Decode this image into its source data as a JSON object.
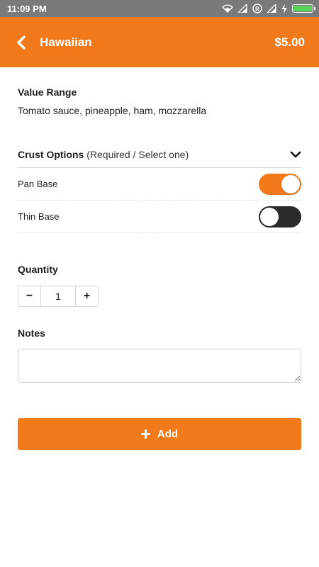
{
  "status_bar": {
    "time": "11:09 PM",
    "icons": [
      "wifi-icon",
      "signal-icon",
      "registered-icon",
      "signal-icon",
      "charging-icon",
      "battery-icon"
    ],
    "battery_level": 1.0,
    "battery_color": "#59d35a"
  },
  "header": {
    "back_icon": "chevron-left-icon",
    "title": "Hawaiian",
    "price": "$5.00",
    "background_color": "#f27a1a"
  },
  "value_range": {
    "label": "Value Range",
    "text": "Tomato sauce, pineapple, ham, mozzarella"
  },
  "crust_options": {
    "title": "Crust Options",
    "subtitle": "(Required / Select one)",
    "expand_icon": "chevron-down-icon",
    "options": [
      {
        "label": "Pan Base",
        "selected": true
      },
      {
        "label": "Thin Base",
        "selected": false
      }
    ]
  },
  "quantity": {
    "label": "Quantity",
    "decrement": "−",
    "value": "1",
    "increment": "+"
  },
  "notes": {
    "label": "Notes",
    "value": "",
    "placeholder": ""
  },
  "add_button": {
    "icon": "plus-icon",
    "label": "Add"
  }
}
